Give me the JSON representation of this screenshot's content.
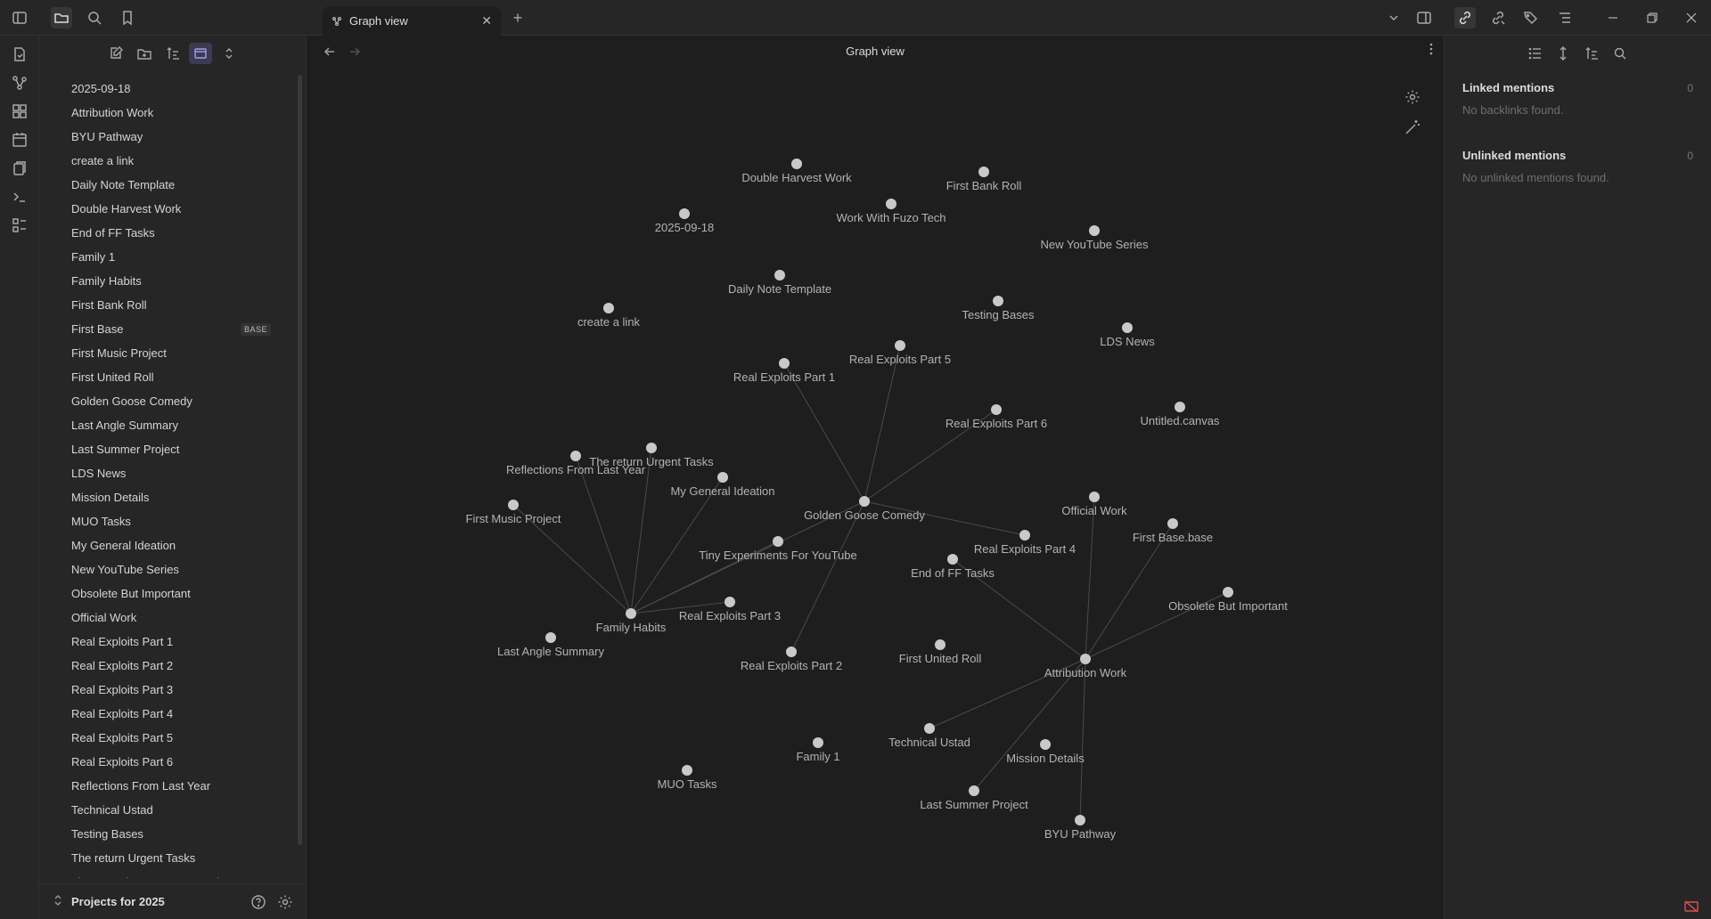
{
  "tab": {
    "title": "Graph view",
    "close": "✕",
    "new_tab": "+"
  },
  "view": {
    "title": "Graph view"
  },
  "explorer": {
    "files": [
      {
        "name": "2025-09-18"
      },
      {
        "name": "Attribution Work"
      },
      {
        "name": "BYU Pathway"
      },
      {
        "name": "create a link"
      },
      {
        "name": "Daily Note Template"
      },
      {
        "name": "Double Harvest Work"
      },
      {
        "name": "End of FF Tasks"
      },
      {
        "name": "Family 1"
      },
      {
        "name": "Family Habits"
      },
      {
        "name": "First Bank Roll"
      },
      {
        "name": "First Base",
        "badge": "BASE"
      },
      {
        "name": "First Music Project"
      },
      {
        "name": "First United Roll"
      },
      {
        "name": "Golden Goose Comedy"
      },
      {
        "name": "Last Angle Summary"
      },
      {
        "name": "Last Summer Project"
      },
      {
        "name": "LDS News"
      },
      {
        "name": "Mission Details"
      },
      {
        "name": "MUO Tasks"
      },
      {
        "name": "My General Ideation"
      },
      {
        "name": "New YouTube Series"
      },
      {
        "name": "Obsolete But Important"
      },
      {
        "name": "Official Work"
      },
      {
        "name": "Real Exploits Part 1"
      },
      {
        "name": "Real Exploits Part 2"
      },
      {
        "name": "Real Exploits Part 3"
      },
      {
        "name": "Real Exploits Part 4"
      },
      {
        "name": "Real Exploits Part 5"
      },
      {
        "name": "Real Exploits Part 6"
      },
      {
        "name": "Reflections From Last Year"
      },
      {
        "name": "Technical Ustad"
      },
      {
        "name": "Testing Bases"
      },
      {
        "name": "The return Urgent Tasks"
      },
      {
        "name": "Tiny Experiments For YouTube"
      }
    ],
    "vault_name": "Projects for 2025"
  },
  "graph": {
    "node_color": "#c9c9c9",
    "edge_color": "#4a4a4a",
    "nodes": [
      {
        "id": "double-harvest",
        "label": "Double Harvest Work"
      },
      {
        "id": "first-bank",
        "label": "First Bank Roll"
      },
      {
        "id": "work-fuzo",
        "label": "Work With Fuzo Tech"
      },
      {
        "id": "d2025",
        "label": "2025-09-18"
      },
      {
        "id": "new-yt",
        "label": "New YouTube Series"
      },
      {
        "id": "daily-note",
        "label": "Daily Note Template"
      },
      {
        "id": "testing-bases",
        "label": "Testing Bases"
      },
      {
        "id": "create-link",
        "label": "create a link"
      },
      {
        "id": "lds-news",
        "label": "LDS News"
      },
      {
        "id": "rep5",
        "label": "Real Exploits Part 5"
      },
      {
        "id": "rep1",
        "label": "Real Exploits Part 1"
      },
      {
        "id": "rep6",
        "label": "Real Exploits Part 6"
      },
      {
        "id": "untitled",
        "label": "Untitled.canvas"
      },
      {
        "id": "urgent",
        "label": "The return Urgent Tasks"
      },
      {
        "id": "reflections",
        "label": "Reflections From Last Year"
      },
      {
        "id": "ideation",
        "label": "My General Ideation"
      },
      {
        "id": "golden",
        "label": "Golden Goose Comedy"
      },
      {
        "id": "official",
        "label": "Official Work"
      },
      {
        "id": "first-music",
        "label": "First Music Project"
      },
      {
        "id": "first-base",
        "label": "First Base.base"
      },
      {
        "id": "rep4",
        "label": "Real Exploits Part 4"
      },
      {
        "id": "tiny",
        "label": "Tiny Experiments For YouTube"
      },
      {
        "id": "end-ff",
        "label": "End of FF Tasks"
      },
      {
        "id": "obsolete",
        "label": "Obsolete But Important"
      },
      {
        "id": "family-habits",
        "label": "Family Habits"
      },
      {
        "id": "rep3",
        "label": "Real Exploits Part 3"
      },
      {
        "id": "last-angle",
        "label": "Last Angle Summary"
      },
      {
        "id": "first-united",
        "label": "First United Roll"
      },
      {
        "id": "rep2",
        "label": "Real Exploits Part 2"
      },
      {
        "id": "attribution",
        "label": "Attribution Work"
      },
      {
        "id": "technical",
        "label": "Technical Ustad"
      },
      {
        "id": "family1",
        "label": "Family 1"
      },
      {
        "id": "mission",
        "label": "Mission Details"
      },
      {
        "id": "muo",
        "label": "MUO Tasks"
      },
      {
        "id": "last-summer",
        "label": "Last Summer Project"
      },
      {
        "id": "byu",
        "label": "BYU Pathway"
      }
    ],
    "edges": [
      [
        "golden",
        "rep1"
      ],
      [
        "golden",
        "rep5"
      ],
      [
        "golden",
        "rep6"
      ],
      [
        "golden",
        "rep4"
      ],
      [
        "golden",
        "rep2"
      ],
      [
        "golden",
        "family-habits"
      ],
      [
        "family-habits",
        "first-music"
      ],
      [
        "family-habits",
        "reflections"
      ],
      [
        "family-habits",
        "urgent"
      ],
      [
        "family-habits",
        "ideation"
      ],
      [
        "family-habits",
        "tiny"
      ],
      [
        "family-habits",
        "rep3"
      ],
      [
        "attribution",
        "official"
      ],
      [
        "attribution",
        "first-base"
      ],
      [
        "attribution",
        "obsolete"
      ],
      [
        "attribution",
        "end-ff"
      ],
      [
        "attribution",
        "technical"
      ],
      [
        "attribution",
        "last-summer"
      ],
      [
        "attribution",
        "byu"
      ]
    ]
  },
  "backlinks": {
    "linked_title": "Linked mentions",
    "linked_count": "0",
    "linked_empty": "No backlinks found.",
    "unlinked_title": "Unlinked mentions",
    "unlinked_count": "0",
    "unlinked_empty": "No unlinked mentions found."
  }
}
